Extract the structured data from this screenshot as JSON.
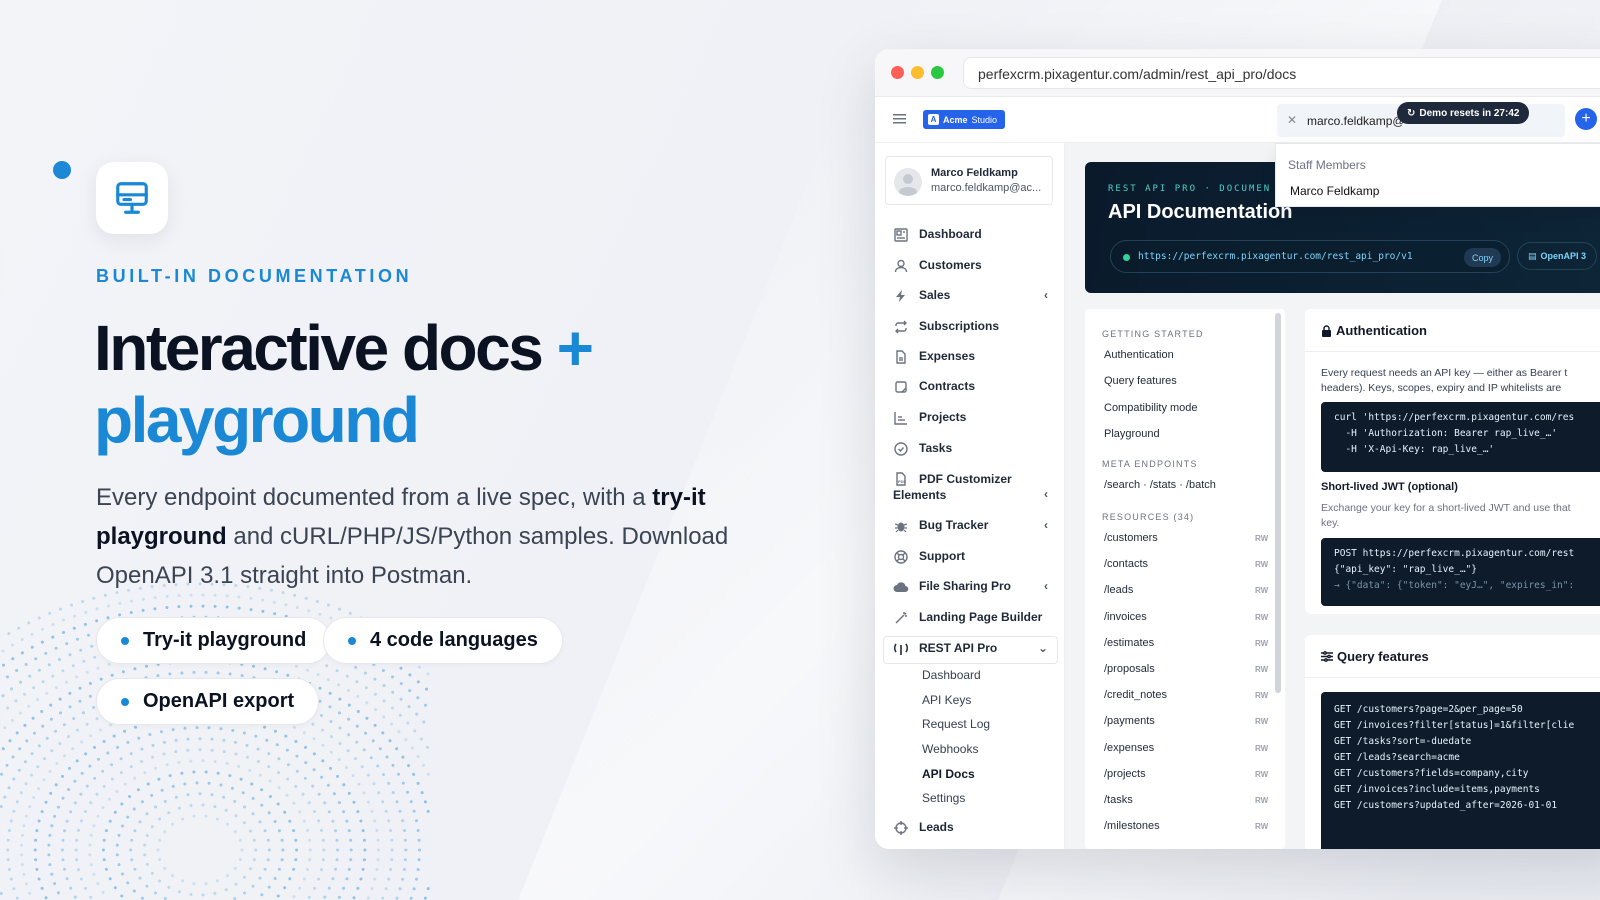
{
  "marketing": {
    "eyebrow": "BUILT-IN DOCUMENTATION",
    "headline_line1": "Interactive docs",
    "headline_plus": "+",
    "headline_line2": "playground",
    "sub_part1": "Every endpoint documented from a live spec, with a ",
    "sub_bold": "try-it playground",
    "sub_part2": " and cURL/PHP/JS/Python samples. Download OpenAPI 3.1 straight into Postman.",
    "chips": [
      "Try-it playground",
      "4 code languages",
      "OpenAPI export"
    ],
    "accent_color": "#1a88d4"
  },
  "browser": {
    "url": "perfexcrm.pixagentur.com/admin/rest_api_pro/docs",
    "traffic_colors": [
      "#ff5f57",
      "#febc2e",
      "#28c840"
    ]
  },
  "topbar": {
    "brand_icon": "A",
    "brand_name": "Acme",
    "brand_suffix": "Studio",
    "search_value": "marco.feldkamp@",
    "demo_badge": "Demo resets in 27:42",
    "add_label": "+"
  },
  "search_dropdown": {
    "group_label": "Staff Members",
    "result": "Marco Feldkamp"
  },
  "user": {
    "name": "Marco Feldkamp",
    "email": "marco.feldkamp@ac..."
  },
  "nav": [
    {
      "label": "Dashboard",
      "icon": "dashboard-icon"
    },
    {
      "label": "Customers",
      "icon": "user-icon"
    },
    {
      "label": "Sales",
      "icon": "bolt-icon",
      "chevron": "‹"
    },
    {
      "label": "Subscriptions",
      "icon": "repeat-icon"
    },
    {
      "label": "Expenses",
      "icon": "file-icon"
    },
    {
      "label": "Contracts",
      "icon": "contract-icon"
    },
    {
      "label": "Projects",
      "icon": "chart-icon"
    },
    {
      "label": "Tasks",
      "icon": "check-circle-icon"
    },
    {
      "label": "PDF Customizer",
      "label2": "Elements",
      "icon": "pdf-icon",
      "chevron": "‹"
    },
    {
      "label": "Bug Tracker",
      "icon": "bug-icon",
      "chevron": "‹"
    },
    {
      "label": "Support",
      "icon": "lifebuoy-icon"
    },
    {
      "label": "File Sharing Pro",
      "icon": "cloud-icon",
      "chevron": "‹"
    },
    {
      "label": "Landing Page Builder",
      "icon": "wand-icon"
    },
    {
      "label": "REST API Pro",
      "icon": "antenna-icon",
      "chevron": "⌄"
    }
  ],
  "nav_sub": [
    "Dashboard",
    "API Keys",
    "Request Log",
    "Webhooks",
    "API Docs",
    "Settings"
  ],
  "nav_after": {
    "label": "Leads",
    "icon": "crosshair-icon"
  },
  "docs_hero": {
    "kicker": "REST API PRO · DOCUMEN",
    "title": "API Documentation",
    "base_url": "https://perfexcrm.pixagentur.com/rest_api_pro/v1",
    "copy_label": "Copy",
    "openapi_label": "OpenAPI 3"
  },
  "toc": {
    "section1": "GETTING STARTED",
    "items1": [
      "Authentication",
      "Query features",
      "Compatibility mode",
      "Playground"
    ],
    "section2": "META ENDPOINTS",
    "items2": [
      "/search · /stats · /batch"
    ],
    "section3": "RESOURCES (34)",
    "resources": [
      "/customers",
      "/contacts",
      "/leads",
      "/invoices",
      "/estimates",
      "/proposals",
      "/credit_notes",
      "/payments",
      "/expenses",
      "/projects",
      "/tasks",
      "/milestones"
    ],
    "rw_label": "RW"
  },
  "auth_card": {
    "title": "Authentication",
    "para_line1": "Every request needs an API key — either as Bearer t",
    "para_line2": "headers). Keys, scopes, expiry and IP whitelists are",
    "code1": [
      "curl 'https://perfexcrm.pixagentur.com/res",
      "  -H 'Authorization: Bearer rap_live_…'",
      "  -H 'X-Api-Key: rap_live_…'"
    ],
    "jwt_title": "Short-lived JWT (optional)",
    "jwt_line1": "Exchange your key for a short-lived JWT and use that",
    "jwt_line2": "key.",
    "code2": [
      "POST https://perfexcrm.pixagentur.com/rest",
      "{\"api_key\": \"rap_live_…\"}"
    ],
    "code2_response": "→ {\"data\": {\"token\": \"eyJ…\", \"expires_in\":"
  },
  "query_card": {
    "title": "Query features",
    "code": [
      "GET /customers?page=2&per_page=50",
      "GET /invoices?filter[status]=1&filter[clie",
      "GET /tasks?sort=-duedate",
      "GET /leads?search=acme",
      "GET /customers?fields=company,city",
      "GET /invoices?include=items,payments",
      "GET /customers?updated_after=2026-01-01"
    ]
  }
}
